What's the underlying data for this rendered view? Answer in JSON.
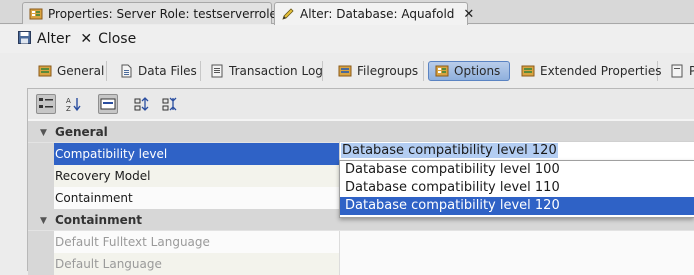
{
  "editor_tabs": [
    {
      "label": "Properties: Server Role: testserverrole",
      "icon": "properties-icon",
      "close": "✕"
    },
    {
      "label": "Alter: Database: Aquafold",
      "icon": "pencil-icon",
      "close": "✕"
    }
  ],
  "toolbar": {
    "alter_label": "Alter",
    "close_label": "Close"
  },
  "page_tabs": [
    "General",
    "Data Files",
    "Transaction Log",
    "Filegroups",
    "Options",
    "Extended Properties",
    "Pr"
  ],
  "selected_page_tab": "Options",
  "grid": {
    "category_general": "General",
    "rows_general": [
      {
        "name": "Compatibility level",
        "value": ""
      },
      {
        "name": "Recovery Model",
        "value": ""
      },
      {
        "name": "Containment",
        "value": ""
      }
    ],
    "category_containment": "Containment",
    "rows_containment": [
      {
        "name": "Default Fulltext Language",
        "value": ""
      },
      {
        "name": "Default Language",
        "value": ""
      }
    ]
  },
  "combo": {
    "value": "Database compatibility level 120",
    "options": [
      "Database compatibility level 100",
      "Database compatibility level 110",
      "Database compatibility level 120"
    ],
    "selected_index": 2
  },
  "colors": {
    "selection": "#2f62c6",
    "accent_tab": "#8fb0dd"
  }
}
